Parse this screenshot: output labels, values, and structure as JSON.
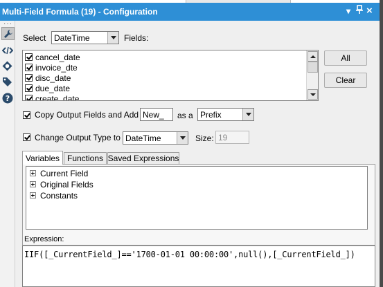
{
  "window": {
    "title": "Multi-Field Formula (19) - Configuration",
    "controls": {
      "dropdown_icon": "chevron-down-icon",
      "pin_icon": "pin-icon",
      "close_icon": "close-icon",
      "dropdown_glyph": "▾",
      "pin_glyph": "ᵻ",
      "close_glyph": "×"
    }
  },
  "sidebar": {
    "icons": [
      "wrench-icon",
      "code-icon",
      "navigate-icon",
      "tag-icon",
      "help-icon"
    ]
  },
  "select_row": {
    "select_label": "Select",
    "select_value": "DateTime",
    "fields_label": "Fields:"
  },
  "fields": [
    {
      "name": "cancel_date",
      "checked": true
    },
    {
      "name": "invoice_dte",
      "checked": true
    },
    {
      "name": "disc_date",
      "checked": true
    },
    {
      "name": "due_date",
      "checked": true
    },
    {
      "name": "create_date",
      "checked": true
    }
  ],
  "buttons": {
    "all": "All",
    "clear": "Clear"
  },
  "copy_output": {
    "label": "Copy Output Fields and Add",
    "checked": true,
    "affix_value": "New_",
    "as_a_label": "as a",
    "affix_type": "Prefix"
  },
  "change_type": {
    "label": "Change Output Type to",
    "checked": true,
    "type_value": "DateTime",
    "size_label": "Size:",
    "size_value": "19"
  },
  "tabs": [
    {
      "label": "Variables",
      "active": true
    },
    {
      "label": "Functions",
      "active": false
    },
    {
      "label": "Saved Expressions",
      "active": false
    }
  ],
  "variables_tree": [
    "Current Field",
    "Original Fields",
    "Constants"
  ],
  "expression": {
    "label": "Expression:",
    "text": "IIF([_CurrentField_]=='1700-01-01 00:00:00',null(),[_CurrentField_])"
  },
  "colors": {
    "titlebar": "#2e8fd6",
    "panel": "#efefef"
  }
}
